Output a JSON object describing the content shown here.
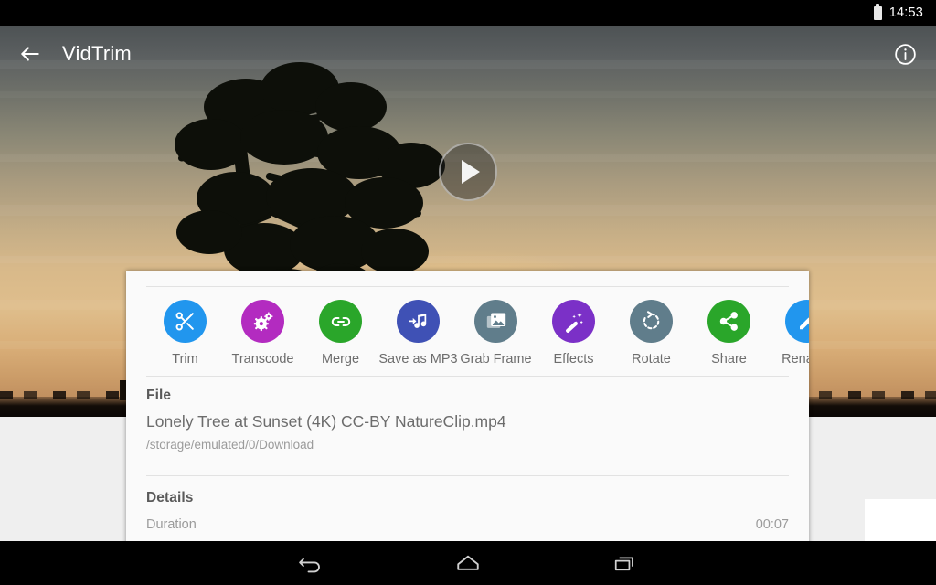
{
  "status_bar": {
    "battery_icon": "battery-icon",
    "time": "14:53"
  },
  "app_bar": {
    "back_icon": "back-arrow-icon",
    "title": "VidTrim",
    "info_icon": "info-icon"
  },
  "video": {
    "play_icon": "play-icon",
    "scene": "sunset with tree silhouette"
  },
  "actions": [
    {
      "label": "Trim",
      "icon": "scissors-icon",
      "color": "#2196ee"
    },
    {
      "label": "Transcode",
      "icon": "gears-icon",
      "color": "#b32bc0"
    },
    {
      "label": "Merge",
      "icon": "link-icon",
      "color": "#2aa62a"
    },
    {
      "label": "Save as MP3",
      "icon": "music-note-icon",
      "color": "#3f51b5"
    },
    {
      "label": "Grab Frame",
      "icon": "photos-icon",
      "color": "#607d8b"
    },
    {
      "label": "Effects",
      "icon": "magic-wand-icon",
      "color": "#7b30c7"
    },
    {
      "label": "Rotate",
      "icon": "rotate-icon",
      "color": "#607d8b"
    },
    {
      "label": "Share",
      "icon": "share-icon",
      "color": "#2aa62a"
    },
    {
      "label": "Rename",
      "icon": "pencil-icon",
      "color": "#2196ee"
    }
  ],
  "file_section": {
    "title": "File",
    "name": "Lonely Tree at Sunset (4K) CC-BY NatureClip.mp4",
    "path": "/storage/emulated/0/Download"
  },
  "details_section": {
    "title": "Details",
    "rows": [
      {
        "label": "Duration",
        "value": "00:07"
      }
    ]
  },
  "nav_bar": {
    "back_icon": "nav-back-icon",
    "home_icon": "nav-home-icon",
    "recents_icon": "nav-recents-icon"
  }
}
